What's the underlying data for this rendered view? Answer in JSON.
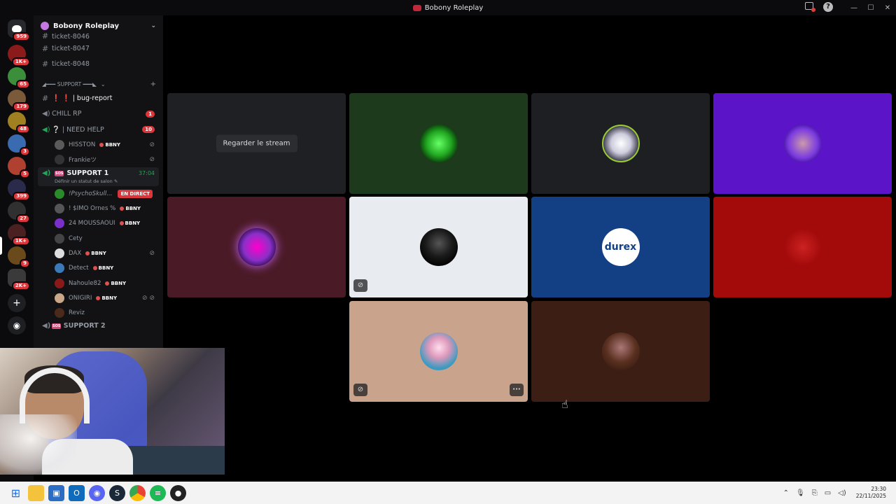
{
  "window": {
    "title": "Bobony Roleplay"
  },
  "rail": {
    "servers": [
      {
        "badge": "959",
        "color": "#26282c"
      },
      {
        "badge": "1K+",
        "color": "#8b1a1a"
      },
      {
        "badge": "65",
        "color": "#3b8f3b"
      },
      {
        "badge": "179",
        "color": "#7b5a3a"
      },
      {
        "badge": "48",
        "color": "#a08020"
      },
      {
        "badge": "3",
        "color": "#3a6ab0"
      },
      {
        "badge": "5",
        "color": "#b04030"
      },
      {
        "badge": "399",
        "color": "#2a2a4a"
      },
      {
        "badge": "27",
        "color": "#303030"
      },
      {
        "badge": "1K+",
        "color": "#4a2020"
      },
      {
        "badge": "9",
        "color": "#6a4a1a"
      },
      {
        "badge": "2K+",
        "color": "#3a3a3a"
      }
    ]
  },
  "sidebar": {
    "server_name": "Bobony Roleplay",
    "top_channels": [
      "ticket-8046",
      "ticket-8047",
      "ticket-8048"
    ],
    "category": "◢━━━ SUPPORT ━━━◣",
    "bug_channel": "❗ ❗ | bug-report",
    "chill": {
      "label": "CHILL RP",
      "count": "1"
    },
    "need_help": {
      "label": "❔ | NEED HELP",
      "count": "10"
    },
    "need_help_users": [
      {
        "name": "HISSTON",
        "tag": "BBNY"
      },
      {
        "name": "Frankieツ",
        "tag": ""
      }
    ],
    "support1": {
      "label": "SUPPORT 1",
      "timer": "37:04",
      "status": "Définir un statut de salon"
    },
    "support1_users": [
      {
        "name": "!PsychoSkull...",
        "tag": "",
        "live": "EN DIRECT"
      },
      {
        "name": "! $IMO Ornes %",
        "tag": "BBNY"
      },
      {
        "name": "24 MOUSSAOUI",
        "tag": "BBNY"
      },
      {
        "name": "Cety",
        "tag": ""
      },
      {
        "name": "DAX",
        "tag": "BBNY"
      },
      {
        "name": "Detect",
        "tag": "BBNY"
      },
      {
        "name": "Nahoule82",
        "tag": "BBNY"
      },
      {
        "name": "ONIGIRI",
        "tag": "BBNY"
      },
      {
        "name": "Reviz",
        "tag": ""
      }
    ],
    "support2": {
      "label": "SUPPORT 2"
    }
  },
  "stage": {
    "watch_label": "Regarder le stream",
    "tiles": [
      {
        "bg": "#1f2023",
        "avatar": ""
      },
      {
        "bg": "#1d3a1c",
        "avatar": "#3fd33f"
      },
      {
        "bg": "#1e1f22",
        "avatar": "#c8d4c0"
      },
      {
        "bg": "#5b14c8",
        "avatar": "#7a3ae0"
      },
      {
        "bg": "#4a1a26",
        "avatar": "#8a30c8"
      },
      {
        "bg": "#e8ebef",
        "avatar": "#1a1a1a"
      },
      {
        "bg": "#134085",
        "avatar": "#ffffff"
      },
      {
        "bg": "#a30a0a",
        "avatar": "#a30a0a"
      },
      {
        "bg": "#c9a38c",
        "avatar": "#9ad0e8"
      },
      {
        "bg": "#3c1e14",
        "avatar": "#5a3020"
      }
    ],
    "logo_text": "durex"
  },
  "taskbar": {
    "time": "23:30",
    "date": "22/11/2025"
  }
}
